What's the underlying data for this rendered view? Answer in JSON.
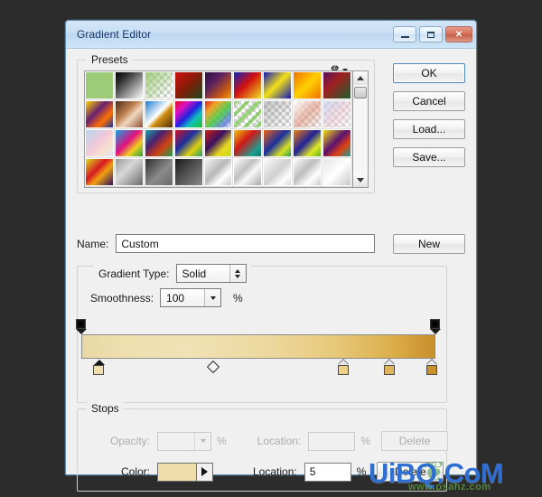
{
  "window": {
    "title": "Gradient Editor",
    "buttons": {
      "minimize": "minimize-icon",
      "maximize": "maximize-icon",
      "close": "✕"
    }
  },
  "presets": {
    "legend": "Presets",
    "gear_icon": "gear-icon",
    "scrollbar": {
      "up": "scroll-up-icon",
      "down": "scroll-down-icon"
    },
    "swatches": [
      {
        "name": "green-solid",
        "css": "linear-gradient(135deg,#9ccb79,#9ccb79)",
        "alpha": false
      },
      {
        "name": "black-white",
        "css": "linear-gradient(135deg,#000000 0%,#3a3a3a 30%,#ffffff 100%)",
        "alpha": false
      },
      {
        "name": "green-transparent",
        "css": "linear-gradient(135deg,#9ccb79 0%,rgba(156,203,121,0) 85%)",
        "alpha": true
      },
      {
        "name": "red-dark-green",
        "css": "linear-gradient(135deg,#cc1111 0%,#8a1a08 45%,#1d4a1a 100%)",
        "alpha": false
      },
      {
        "name": "purple-orange",
        "css": "linear-gradient(135deg,#2a1040 0%,#5a2060 35%,#c85a10 75%,#f0a020 100%)",
        "alpha": false
      },
      {
        "name": "blue-red-yellow",
        "css": "linear-gradient(135deg,#1020c0 0%,#d01010 45%,#f0e020 100%)",
        "alpha": false
      },
      {
        "name": "blue-yellow",
        "css": "linear-gradient(135deg,#1018b8 0%,#f2e018 48%,#1018b8 100%)",
        "alpha": false
      },
      {
        "name": "orange-yellow",
        "css": "linear-gradient(135deg,#f07000 0%,#ffd000 50%,#f07000 100%)",
        "alpha": false
      },
      {
        "name": "purple-green",
        "css": "linear-gradient(135deg,#5a1060 0%,#a02020 40%,#1a6030 100%)",
        "alpha": false
      },
      {
        "name": "yellow-violet-orange",
        "css": "linear-gradient(135deg,#ffd400 0%,#6a2070 40%,#ff7000 70%,#1030a0 100%)",
        "alpha": false
      },
      {
        "name": "copper",
        "css": "linear-gradient(135deg,#4a2a18 0%,#c08050 40%,#f0d8c0 60%,#8a5030 100%)",
        "alpha": false
      },
      {
        "name": "blue-brown-white",
        "css": "linear-gradient(135deg,#1a7ad0 0%,#ffffff 48%,#d09010 60%,#503010 100%)",
        "alpha": false
      },
      {
        "name": "spectrum",
        "css": "linear-gradient(135deg,#e01010 0%,#e010c0 25%,#2020e0 50%,#10c0c0 70%,#20c020 100%)",
        "alpha": false
      },
      {
        "name": "rainbow-transparent",
        "css": "linear-gradient(135deg,rgba(224,16,16,.95) 0%,rgba(240,160,20,.9) 25%,rgba(60,200,60,.85) 55%,rgba(40,80,220,.6) 80%,rgba(255,255,255,0) 100%)",
        "alpha": true
      },
      {
        "name": "green-stripes-transparent",
        "css": "repeating-linear-gradient(135deg,rgba(120,200,80,.75) 0 4px,rgba(255,255,255,0) 4px 9px)",
        "alpha": true
      },
      {
        "name": "gray-transparent",
        "css": "linear-gradient(135deg,rgba(150,150,150,.55) 0%,rgba(255,255,255,0) 100%)",
        "alpha": true
      },
      {
        "name": "pink-white-transparent",
        "css": "linear-gradient(135deg,rgba(255,255,255,.9) 0%,rgba(225,160,140,.7) 50%,rgba(255,255,255,0) 100%)",
        "alpha": true
      },
      {
        "name": "pastel-transparent",
        "css": "linear-gradient(135deg,rgba(200,215,240,.8) 0%,rgba(235,200,210,.6) 50%,rgba(255,255,255,.15) 100%)",
        "alpha": true
      },
      {
        "name": "pastel-pink-blue",
        "css": "linear-gradient(135deg,#b8d8f0 0%,#f0c8d8 45%,#f8e0d0 75%,#d8e8f4 100%)",
        "alpha": false
      },
      {
        "name": "cyan-magenta-green",
        "css": "linear-gradient(135deg,#10a8e0 0%,#e01080 45%,#f0d020 70%,#20a040 100%)",
        "alpha": false
      },
      {
        "name": "teal-purple-green",
        "css": "linear-gradient(135deg,#18a8a8 0%,#4a2070 35%,#d04010 65%,#20a050 100%)",
        "alpha": false
      },
      {
        "name": "red-blue-yellow",
        "css": "linear-gradient(135deg,#d01020 0%,#1a30a0 40%,#e0d010 70%,#20a060 100%)",
        "alpha": false
      },
      {
        "name": "red-purple-yellow",
        "css": "linear-gradient(135deg,#d02010 0%,#3a1060 40%,#e8d820 70%,#c8d820 100%)",
        "alpha": false
      },
      {
        "name": "yellow-red-teal",
        "css": "linear-gradient(135deg,#f0c810 0%,#d01818 40%,#18a090 80%,#1a7060 100%)",
        "alpha": false
      },
      {
        "name": "orange-blue-green",
        "css": "linear-gradient(135deg,#f06010 0%,#1a30a0 45%,#d8e020 75%,#20a050 100%)",
        "alpha": false
      },
      {
        "name": "orange-navy-lime",
        "css": "linear-gradient(135deg,#f08010 0%,#20209a 45%,#e0e820 75%,#60b020 100%)",
        "alpha": false
      },
      {
        "name": "yellow-purple-teal",
        "css": "linear-gradient(135deg,#f0e010 0%,#5a1070 45%,#e04010 70%,#18a0a0 100%)",
        "alpha": false
      },
      {
        "name": "yellow-red-violet",
        "css": "linear-gradient(135deg,#d8e020 0%,#d81820 40%,#f0a010 60%,#2a1060 100%)",
        "alpha": false
      },
      {
        "name": "gray-metal-1",
        "css": "linear-gradient(135deg,#9a9a9a 0%,#d8d8d8 40%,#6a6a6a 100%)",
        "alpha": false
      },
      {
        "name": "dark-gray-metal",
        "css": "linear-gradient(135deg,#2e2e2e 0%,#8a8a8a 55%,#6a6a6a 100%)",
        "alpha": false
      },
      {
        "name": "black-gray-metal",
        "css": "linear-gradient(135deg,#1a1a1a 0%,#4a4a4a 40%,#8a8a8a 100%)",
        "alpha": false
      },
      {
        "name": "silver-1",
        "css": "linear-gradient(135deg,#f4f4f4 0%,#b8b8b8 45%,#ffffff 70%,#c8c8c8 100%)",
        "alpha": false
      },
      {
        "name": "silver-2",
        "css": "linear-gradient(135deg,#ffffff 0%,#c0c0c0 40%,#f8f8f8 60%,#a8a8a8 100%)",
        "alpha": false
      },
      {
        "name": "silver-3",
        "css": "linear-gradient(135deg,#fbfbfb 0%,#cfcfcf 50%,#ffffff 78%,#d8d8d8 100%)",
        "alpha": false
      },
      {
        "name": "silver-4",
        "css": "linear-gradient(135deg,#ffffff 0%,#bdbdbd 42%,#ffffff 72%,#cacaca 100%)",
        "alpha": false
      },
      {
        "name": "silver-5",
        "css": "linear-gradient(135deg,#e4e4e4 0%,#ffffff 50%,#c8c8c8 100%)",
        "alpha": false
      }
    ]
  },
  "actions": {
    "ok": "OK",
    "cancel": "Cancel",
    "load": "Load...",
    "save": "Save...",
    "new": "New"
  },
  "name_field": {
    "label": "Name:",
    "value": "Custom"
  },
  "gradient": {
    "type_label": "Gradient Type:",
    "type_value": "Solid",
    "smoothness_label": "Smoothness:",
    "smoothness_value": "100",
    "smoothness_percent": "%",
    "bar_css": "linear-gradient(90deg,#e9d8a6 0%,#eedfae 12%,#f0e2b4 30%,#edd9a0 52%,#e6c878 72%,#dcae4b 88%,#c98f2a 100%)",
    "opacity_stops": [
      {
        "name": "opacity-stop-start",
        "position_pct": 0,
        "opacity": 100
      },
      {
        "name": "opacity-stop-end",
        "position_pct": 100,
        "opacity": 100
      }
    ],
    "color_stops": [
      {
        "name": "color-stop-1",
        "position_pct": 5,
        "color": "#efdeb0",
        "selected": true
      },
      {
        "name": "color-stop-2",
        "position_pct": 74,
        "color": "#ecd18b",
        "selected": false
      },
      {
        "name": "color-stop-3",
        "position_pct": 87,
        "color": "#e0b45c",
        "selected": false
      },
      {
        "name": "color-stop-4",
        "position_pct": 99,
        "color": "#c8922c",
        "selected": false
      }
    ],
    "midpoint_pct": 37
  },
  "stops": {
    "legend": "Stops",
    "opacity": {
      "label": "Opacity:",
      "value": "",
      "percent": "%",
      "delete_label": "Delete",
      "disabled": true
    },
    "color": {
      "label": "Color:",
      "swatch_hex": "#eedcab",
      "location_label": "Location:",
      "location_value": "5",
      "percent": "%",
      "delete_label": "Delete",
      "disabled": false
    },
    "opacity_location_label": "Location:"
  },
  "watermark": {
    "text": "UiBQ.CoM",
    "sub": "www.psahz.com",
    "leaf": "❦"
  }
}
